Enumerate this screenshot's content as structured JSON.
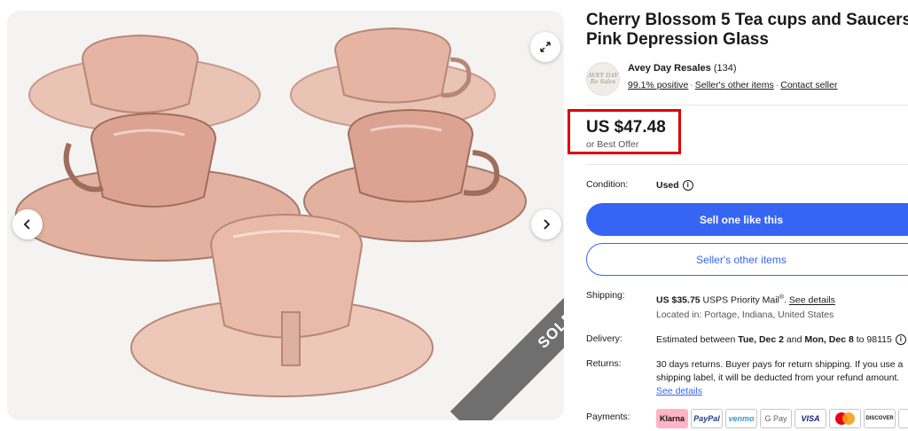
{
  "gallery": {
    "sold_label": "SOLD",
    "expand_icon": "expand-icon",
    "prev_icon": "chevron-left-icon",
    "next_icon": "chevron-right-icon"
  },
  "listing": {
    "title": "Cherry Blossom 5 Tea cups and Saucers Pink Depression Glass"
  },
  "seller": {
    "logo_text": "AVEY DAY Re Sales",
    "name": "Avey Day Resales",
    "feedback_count": "(134)",
    "positive": "99.1% positive",
    "other_items": "Seller's other items",
    "contact": "Contact seller"
  },
  "price": {
    "amount": "US $47.48",
    "offer": "or Best Offer"
  },
  "condition": {
    "label": "Condition:",
    "value": "Used"
  },
  "actions": {
    "primary": "Sell one like this",
    "secondary": "Seller's other items"
  },
  "shipping": {
    "label": "Shipping:",
    "cost": "US $35.75",
    "service": "USPS Priority Mail",
    "reg": "®",
    "details": "See details",
    "location": "Located in: Portage, Indiana, United States"
  },
  "delivery": {
    "label": "Delivery:",
    "prefix": "Estimated between",
    "start": "Tue, Dec 2",
    "and": "and",
    "end": "Mon, Dec 8",
    "to": "to 98115"
  },
  "returns": {
    "label": "Returns:",
    "line1": "30 days returns. Buyer pays for return shipping. If you use a",
    "line2": "shipping label, it will be deducted from your refund amount.",
    "details": "See details"
  },
  "payments": {
    "label": "Payments:",
    "methods": [
      "Klarna",
      "PayPal",
      "venmo",
      "G Pay",
      "VISA",
      "",
      "DISCOVER",
      ""
    ]
  },
  "colors": {
    "accent": "#3665f3",
    "highlight_box": "#e00000"
  }
}
